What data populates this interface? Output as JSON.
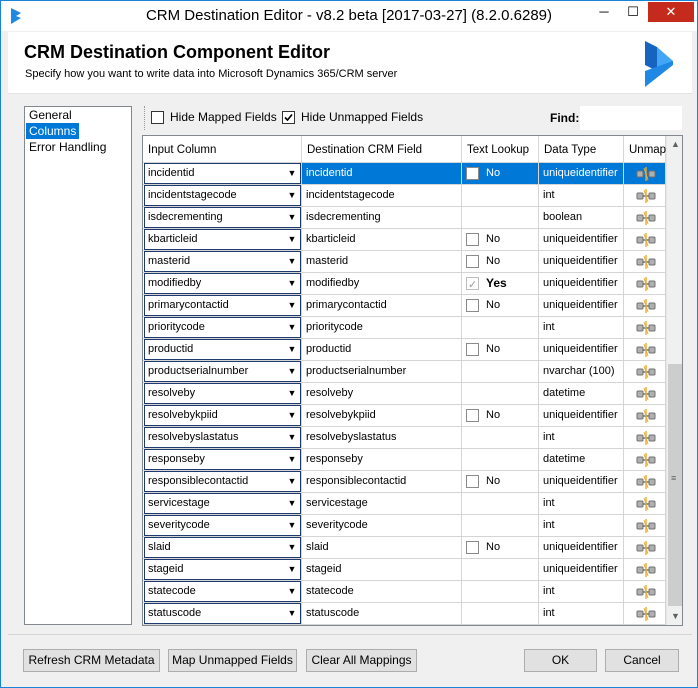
{
  "window": {
    "title": "CRM Destination Editor - v8.2 beta [2017-03-27] (8.2.0.6289)",
    "minimize_label": "─",
    "maximize_label": "☐",
    "close_label": "✕"
  },
  "header": {
    "title": "CRM Destination Component Editor",
    "subtitle": "Specify how you want to write data into Microsoft Dynamics 365/CRM server"
  },
  "nav": {
    "items": [
      {
        "label": "General",
        "selected": false
      },
      {
        "label": "Columns",
        "selected": true
      },
      {
        "label": "Error Handling",
        "selected": false
      }
    ]
  },
  "filters": {
    "hide_mapped": {
      "label": "Hide Mapped Fields",
      "checked": false
    },
    "hide_unmapped": {
      "label": "Hide Unmapped Fields",
      "checked": true
    },
    "find_label": "Find:",
    "find_value": ""
  },
  "grid": {
    "columns": [
      "Input Column",
      "Destination CRM Field",
      "Text Lookup",
      "Data Type",
      "Unmap"
    ],
    "rows": [
      {
        "input": "incidentid",
        "dest": "incidentid",
        "lookup": "No",
        "lookup_checked": false,
        "type": "uniqueidentifier",
        "selected": true
      },
      {
        "input": "incidentstagecode",
        "dest": "incidentstagecode",
        "lookup": null,
        "lookup_checked": false,
        "type": "int"
      },
      {
        "input": "isdecrementing",
        "dest": "isdecrementing",
        "lookup": null,
        "lookup_checked": false,
        "type": "boolean"
      },
      {
        "input": "kbarticleid",
        "dest": "kbarticleid",
        "lookup": "No",
        "lookup_checked": false,
        "type": "uniqueidentifier"
      },
      {
        "input": "masterid",
        "dest": "masterid",
        "lookup": "No",
        "lookup_checked": false,
        "type": "uniqueidentifier"
      },
      {
        "input": "modifiedby",
        "dest": "modifiedby",
        "lookup": "Yes",
        "lookup_checked": true,
        "type": "uniqueidentifier"
      },
      {
        "input": "primarycontactid",
        "dest": "primarycontactid",
        "lookup": "No",
        "lookup_checked": false,
        "type": "uniqueidentifier"
      },
      {
        "input": "prioritycode",
        "dest": "prioritycode",
        "lookup": null,
        "lookup_checked": false,
        "type": "int"
      },
      {
        "input": "productid",
        "dest": "productid",
        "lookup": "No",
        "lookup_checked": false,
        "type": "uniqueidentifier"
      },
      {
        "input": "productserialnumber",
        "dest": "productserialnumber",
        "lookup": null,
        "lookup_checked": false,
        "type": "nvarchar (100)"
      },
      {
        "input": "resolveby",
        "dest": "resolveby",
        "lookup": null,
        "lookup_checked": false,
        "type": "datetime"
      },
      {
        "input": "resolvebykpiid",
        "dest": "resolvebykpiid",
        "lookup": "No",
        "lookup_checked": false,
        "type": "uniqueidentifier"
      },
      {
        "input": "resolvebyslastatus",
        "dest": "resolvebyslastatus",
        "lookup": null,
        "lookup_checked": false,
        "type": "int"
      },
      {
        "input": "responseby",
        "dest": "responseby",
        "lookup": null,
        "lookup_checked": false,
        "type": "datetime"
      },
      {
        "input": "responsiblecontactid",
        "dest": "responsiblecontactid",
        "lookup": "No",
        "lookup_checked": false,
        "type": "uniqueidentifier"
      },
      {
        "input": "servicestage",
        "dest": "servicestage",
        "lookup": null,
        "lookup_checked": false,
        "type": "int"
      },
      {
        "input": "severitycode",
        "dest": "severitycode",
        "lookup": null,
        "lookup_checked": false,
        "type": "int"
      },
      {
        "input": "slaid",
        "dest": "slaid",
        "lookup": "No",
        "lookup_checked": false,
        "type": "uniqueidentifier"
      },
      {
        "input": "stageid",
        "dest": "stageid",
        "lookup": null,
        "lookup_checked": false,
        "type": "uniqueidentifier"
      },
      {
        "input": "statecode",
        "dest": "statecode",
        "lookup": null,
        "lookup_checked": false,
        "type": "int"
      },
      {
        "input": "statuscode",
        "dest": "statuscode",
        "lookup": null,
        "lookup_checked": false,
        "type": "int"
      }
    ]
  },
  "buttons": {
    "refresh": "Refresh CRM Metadata",
    "map_unmapped": "Map Unmapped Fields",
    "clear_all": "Clear All Mappings",
    "ok": "OK",
    "cancel": "Cancel"
  },
  "colors": {
    "accent": "#0078d7",
    "close": "#c42b1c",
    "logo": "#1e88e5"
  }
}
